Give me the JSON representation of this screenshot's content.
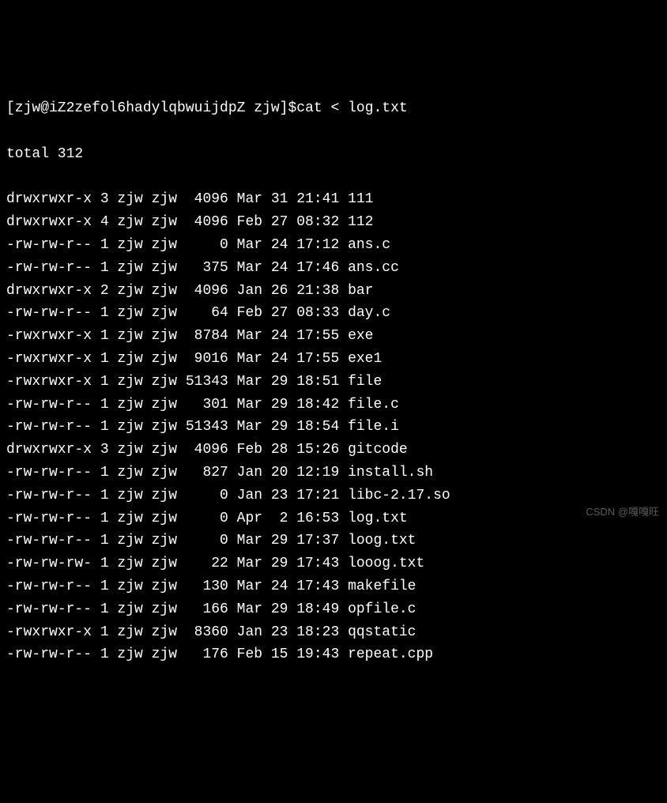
{
  "prompt": {
    "user_host": "[zjw@iZ2zefol6hadylqbwuijdpZ zjw]",
    "symbol": "$",
    "command": "cat < log.txt"
  },
  "total_line": "total 312",
  "listing": [
    {
      "perms": "drwxrwxr-x",
      "links": "3",
      "owner": "zjw",
      "group": "zjw",
      "size": "4096",
      "month": "Mar",
      "day": "31",
      "time": "21:41",
      "name": "111"
    },
    {
      "perms": "drwxrwxr-x",
      "links": "4",
      "owner": "zjw",
      "group": "zjw",
      "size": "4096",
      "month": "Feb",
      "day": "27",
      "time": "08:32",
      "name": "112"
    },
    {
      "perms": "-rw-rw-r--",
      "links": "1",
      "owner": "zjw",
      "group": "zjw",
      "size": "0",
      "month": "Mar",
      "day": "24",
      "time": "17:12",
      "name": "ans.c"
    },
    {
      "perms": "-rw-rw-r--",
      "links": "1",
      "owner": "zjw",
      "group": "zjw",
      "size": "375",
      "month": "Mar",
      "day": "24",
      "time": "17:46",
      "name": "ans.cc"
    },
    {
      "perms": "drwxrwxr-x",
      "links": "2",
      "owner": "zjw",
      "group": "zjw",
      "size": "4096",
      "month": "Jan",
      "day": "26",
      "time": "21:38",
      "name": "bar"
    },
    {
      "perms": "-rw-rw-r--",
      "links": "1",
      "owner": "zjw",
      "group": "zjw",
      "size": "64",
      "month": "Feb",
      "day": "27",
      "time": "08:33",
      "name": "day.c"
    },
    {
      "perms": "-rwxrwxr-x",
      "links": "1",
      "owner": "zjw",
      "group": "zjw",
      "size": "8784",
      "month": "Mar",
      "day": "24",
      "time": "17:55",
      "name": "exe"
    },
    {
      "perms": "-rwxrwxr-x",
      "links": "1",
      "owner": "zjw",
      "group": "zjw",
      "size": "9016",
      "month": "Mar",
      "day": "24",
      "time": "17:55",
      "name": "exe1"
    },
    {
      "perms": "-rwxrwxr-x",
      "links": "1",
      "owner": "zjw",
      "group": "zjw",
      "size": "51343",
      "month": "Mar",
      "day": "29",
      "time": "18:51",
      "name": "file"
    },
    {
      "perms": "-rw-rw-r--",
      "links": "1",
      "owner": "zjw",
      "group": "zjw",
      "size": "301",
      "month": "Mar",
      "day": "29",
      "time": "18:42",
      "name": "file.c"
    },
    {
      "perms": "-rw-rw-r--",
      "links": "1",
      "owner": "zjw",
      "group": "zjw",
      "size": "51343",
      "month": "Mar",
      "day": "29",
      "time": "18:54",
      "name": "file.i"
    },
    {
      "perms": "drwxrwxr-x",
      "links": "3",
      "owner": "zjw",
      "group": "zjw",
      "size": "4096",
      "month": "Feb",
      "day": "28",
      "time": "15:26",
      "name": "gitcode"
    },
    {
      "perms": "-rw-rw-r--",
      "links": "1",
      "owner": "zjw",
      "group": "zjw",
      "size": "827",
      "month": "Jan",
      "day": "20",
      "time": "12:19",
      "name": "install.sh"
    },
    {
      "perms": "-rw-rw-r--",
      "links": "1",
      "owner": "zjw",
      "group": "zjw",
      "size": "0",
      "month": "Jan",
      "day": "23",
      "time": "17:21",
      "name": "libc-2.17.so"
    },
    {
      "perms": "-rw-rw-r--",
      "links": "1",
      "owner": "zjw",
      "group": "zjw",
      "size": "0",
      "month": "Apr",
      "day": "2",
      "time": "16:53",
      "name": "log.txt"
    },
    {
      "perms": "-rw-rw-r--",
      "links": "1",
      "owner": "zjw",
      "group": "zjw",
      "size": "0",
      "month": "Mar",
      "day": "29",
      "time": "17:37",
      "name": "loog.txt"
    },
    {
      "perms": "-rw-rw-rw-",
      "links": "1",
      "owner": "zjw",
      "group": "zjw",
      "size": "22",
      "month": "Mar",
      "day": "29",
      "time": "17:43",
      "name": "looog.txt"
    },
    {
      "perms": "-rw-rw-r--",
      "links": "1",
      "owner": "zjw",
      "group": "zjw",
      "size": "130",
      "month": "Mar",
      "day": "24",
      "time": "17:43",
      "name": "makefile"
    },
    {
      "perms": "-rw-rw-r--",
      "links": "1",
      "owner": "zjw",
      "group": "zjw",
      "size": "166",
      "month": "Mar",
      "day": "29",
      "time": "18:49",
      "name": "opfile.c"
    },
    {
      "perms": "-rwxrwxr-x",
      "links": "1",
      "owner": "zjw",
      "group": "zjw",
      "size": "8360",
      "month": "Jan",
      "day": "23",
      "time": "18:23",
      "name": "qqstatic"
    },
    {
      "perms": "-rw-rw-r--",
      "links": "1",
      "owner": "zjw",
      "group": "zjw",
      "size": "176",
      "month": "Feb",
      "day": "15",
      "time": "19:43",
      "name": "repeat.cpp"
    }
  ],
  "watermark": "CSDN @嘎嘎旺"
}
